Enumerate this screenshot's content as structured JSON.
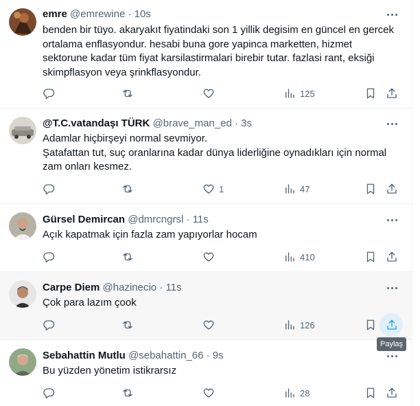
{
  "tweets": [
    {
      "name": "emre",
      "handle": "@emrewine",
      "time": "10s",
      "text": "benden bir tüyo. akaryakıt fiyatindaki son 1 yillik degisim en güncel en gercek ortalama enflasyondur. hesabi buna gore yapinca marketten, hizmet sektorune kadar tüm fiyat karsilastirmalari birebir tutar. fazlasi rant, eksiği skimpflasyon veya şrinkflasyondur.",
      "replies": "",
      "retweets": "",
      "likes": "",
      "views": "125"
    },
    {
      "name": "@T.C.vatandaşı TÜRK",
      "handle": "@brave_man_ed",
      "time": "3s",
      "text": "Adamlar hiçbirşeyi normal sevmiyor.\nŞatafattan tut, suç oranlarına kadar dünya liderliğine oynadıkları için normal zam onları kesmez.",
      "replies": "",
      "retweets": "",
      "likes": "1",
      "views": "47"
    },
    {
      "name": "Gürsel Demircan",
      "handle": "@dmrcngrsl",
      "time": "11s",
      "text": "Açık kapatmak için fazla zam yapıyorlar hocam",
      "replies": "",
      "retweets": "",
      "likes": "",
      "views": "410"
    },
    {
      "name": "Carpe Diem",
      "handle": "@hazinecio",
      "time": "11s",
      "text": "Çok para lazım çook",
      "replies": "",
      "retweets": "",
      "likes": "",
      "views": "126"
    },
    {
      "name": "Sebahattin Mutlu",
      "handle": "@sebahattin_66",
      "time": "9s",
      "text": "Bu yüzden yönetim istikrarsız",
      "replies": "",
      "retweets": "",
      "likes": "",
      "views": "28"
    }
  ],
  "separator": "·",
  "tooltip": "Paylaş",
  "icons": [
    "reply-icon",
    "retweet-icon",
    "like-icon",
    "views-icon",
    "bookmark-icon",
    "share-icon",
    "more-icon"
  ],
  "colors": {
    "text": "#0f1419",
    "muted": "#536471",
    "accent": "#1d9bf0",
    "hover_bg": "#f7f7f7",
    "tooltip_bg": "#5b6670"
  }
}
